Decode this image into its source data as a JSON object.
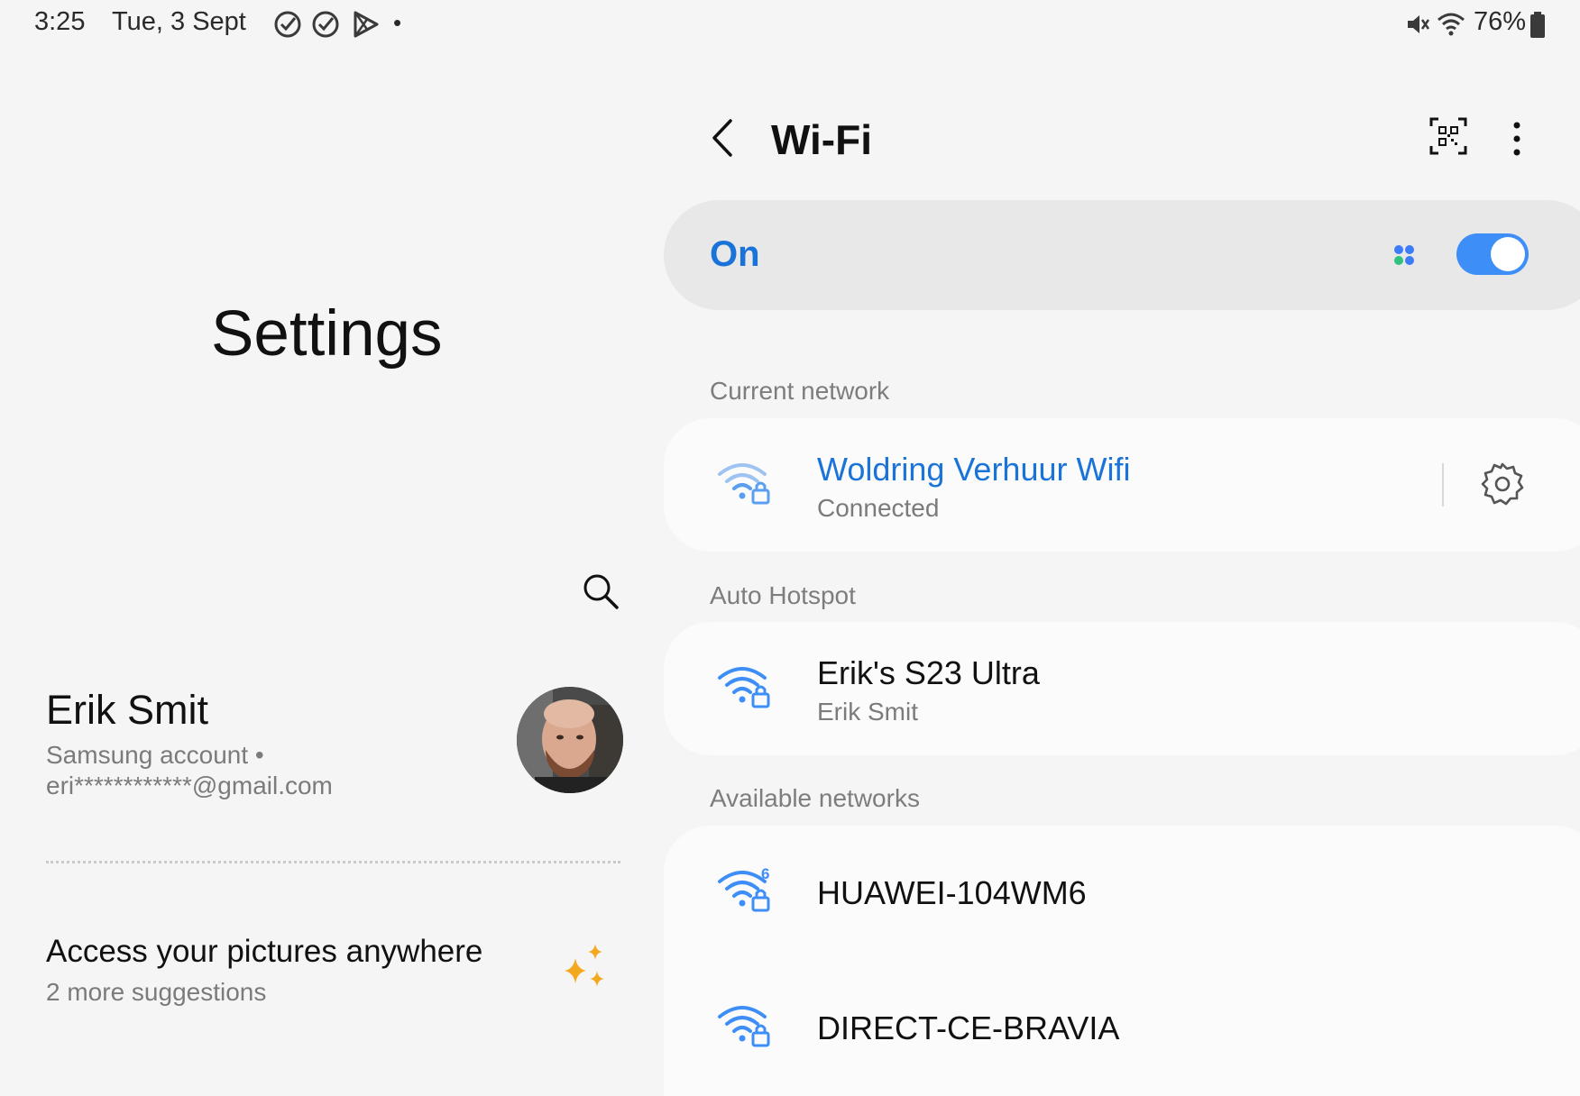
{
  "status_bar": {
    "time": "3:25",
    "date": "Tue, 3 Sept",
    "battery": "76%",
    "dot": "•",
    "icons_left": [
      "check-circle-icon",
      "check-circle-icon",
      "play-store-icon"
    ],
    "icons_right": [
      "mute-icon",
      "wifi-icon",
      "battery-icon"
    ]
  },
  "settings": {
    "title": "Settings",
    "account": {
      "name": "Erik Smit",
      "line1": "Samsung account  •",
      "email": "eri************@gmail.com"
    },
    "suggestion": {
      "title": "Access your pictures anywhere",
      "subtitle": "2 more suggestions"
    }
  },
  "wifi": {
    "title": "Wi-Fi",
    "state_label": "On",
    "toggle_on": true,
    "sections": {
      "current": "Current network",
      "hotspot": "Auto Hotspot",
      "available": "Available networks"
    },
    "current_network": {
      "name": "Woldring Verhuur Wifi",
      "status": "Connected"
    },
    "hotspot_network": {
      "name": "Erik's S23 Ultra",
      "owner": "Erik Smit"
    },
    "available_networks": [
      {
        "name": "HUAWEI-104WM6",
        "badge": "6"
      },
      {
        "name": "DIRECT-CE-BRAVIA"
      }
    ]
  },
  "colors": {
    "accent": "#1a73d9",
    "toggle": "#3e8ef7",
    "sparkle": "#f4a81e"
  }
}
